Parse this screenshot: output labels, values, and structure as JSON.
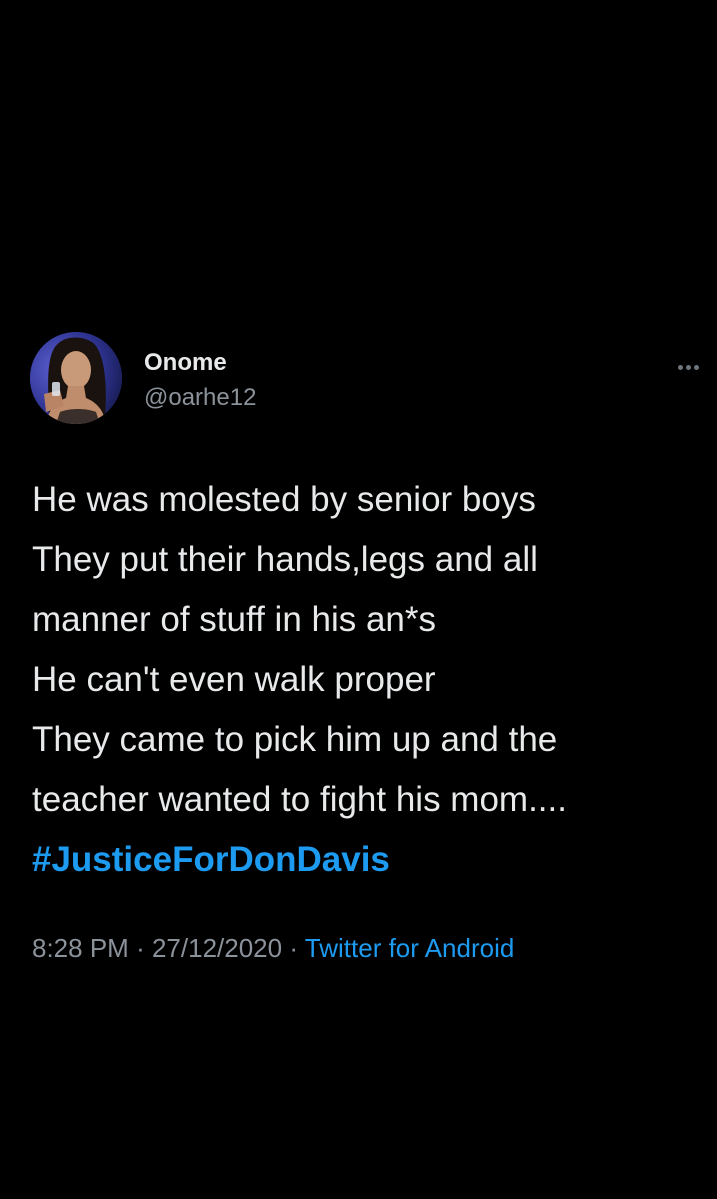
{
  "tweet": {
    "author": {
      "display_name": "Onome",
      "handle": "@oarhe12",
      "avatar_icon": "profile-photo"
    },
    "menu_icon": "more-horizontal-icon",
    "text_lines": [
      "He was molested by senior boys",
      "They put their hands,legs and all",
      "manner of stuff in his an*s",
      "He can't even walk proper",
      "They came to pick him up and the",
      "teacher wanted to fight his mom...."
    ],
    "hashtag": "#JusticeForDonDavis",
    "time": "8:28 PM",
    "separator": "·",
    "date": "27/12/2020",
    "source": "Twitter for Android"
  },
  "colors": {
    "background": "#000000",
    "text": "#e7e9ea",
    "secondary": "#8b9299",
    "accent": "#1d9bf0"
  }
}
